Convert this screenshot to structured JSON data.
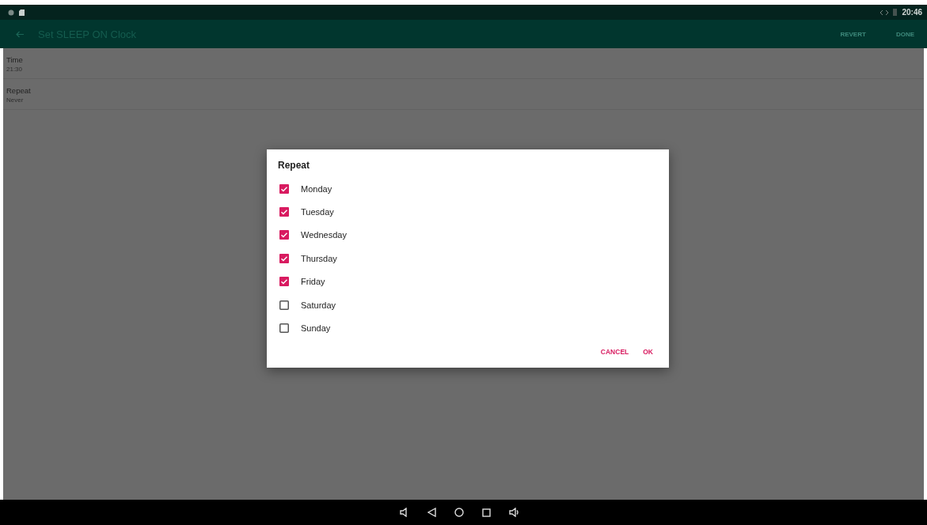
{
  "status_bar": {
    "time": "20:46"
  },
  "app_bar": {
    "title": "Set SLEEP ON Clock",
    "actions": [
      "REVERT",
      "DONE"
    ]
  },
  "settings": [
    {
      "title": "Time",
      "value": "21:30"
    },
    {
      "title": "Repeat",
      "value": "Never"
    }
  ],
  "dialog": {
    "title": "Repeat",
    "options": [
      {
        "label": "Monday",
        "checked": true
      },
      {
        "label": "Tuesday",
        "checked": true
      },
      {
        "label": "Wednesday",
        "checked": true
      },
      {
        "label": "Thursday",
        "checked": true
      },
      {
        "label": "Friday",
        "checked": true
      },
      {
        "label": "Saturday",
        "checked": false
      },
      {
        "label": "Sunday",
        "checked": false
      }
    ],
    "buttons": [
      "CANCEL",
      "OK"
    ]
  }
}
